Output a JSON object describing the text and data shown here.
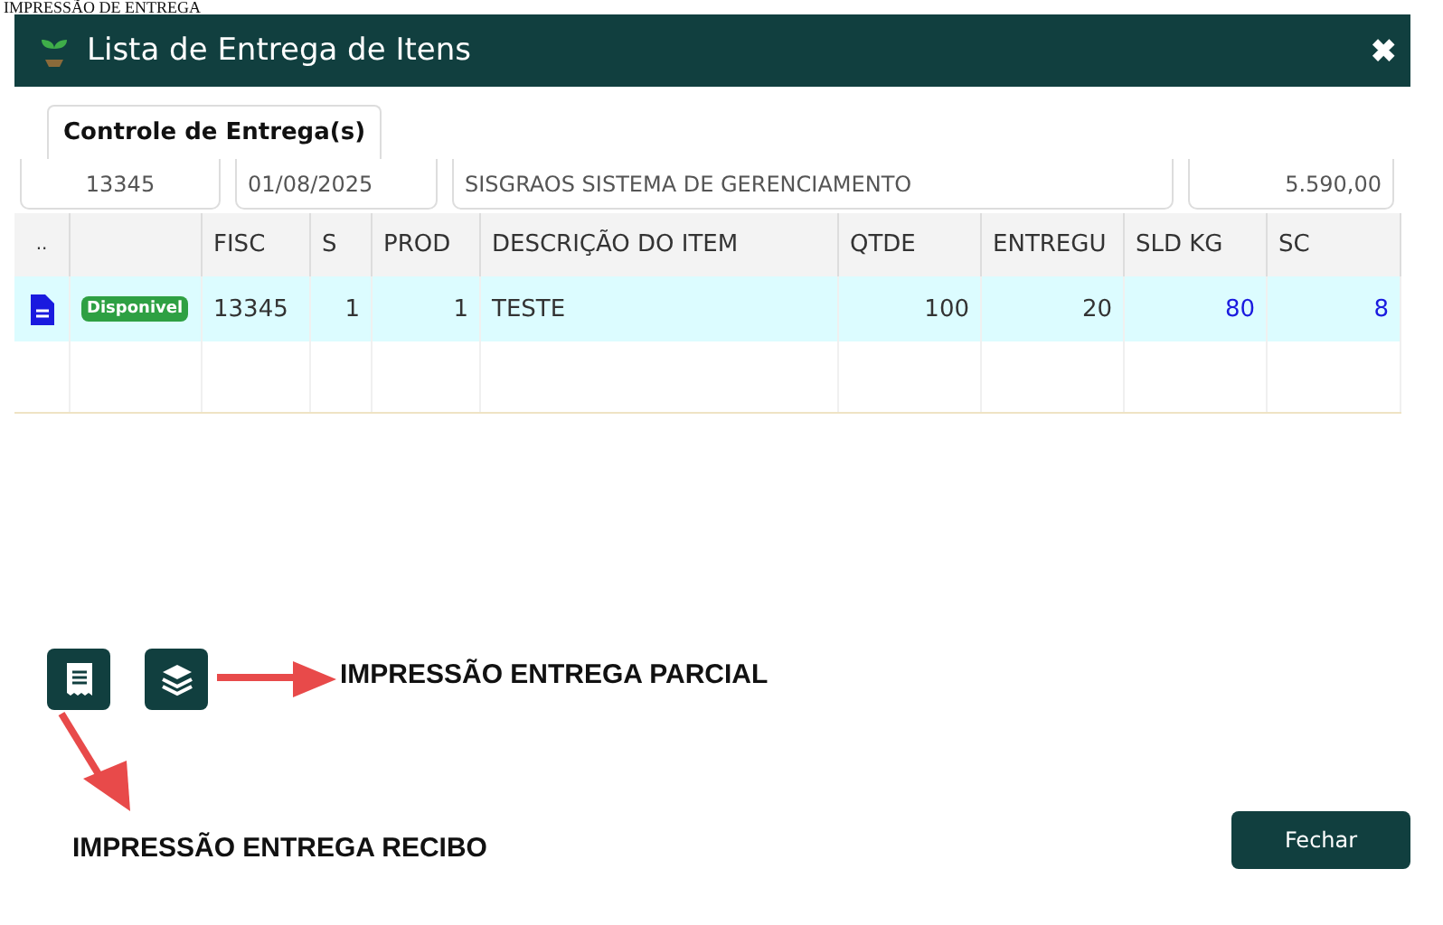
{
  "page_heading": "IMPRESSÃO DE ENTREGA",
  "window": {
    "title": "Lista de Entrega de Itens",
    "close": "✖"
  },
  "tabs": [
    {
      "label": "Controle de Entrega(s)",
      "selected": true
    }
  ],
  "fields": [
    {
      "value": "13345"
    },
    {
      "value": "01/08/2025"
    },
    {
      "value": "SISGRAOS SISTEMA DE GERENCIAMENTO"
    },
    {
      "value": "5.590,00"
    }
  ],
  "table": {
    "columns": [
      "..",
      "",
      "FISC",
      "S",
      "PROD",
      "DESCRIÇÃO DO ITEM",
      "QTDE",
      "ENTREGU",
      "SLD KG",
      "SC"
    ],
    "rows": [
      {
        "selected": true,
        "color": "#2ea043",
        "cells": [
          "",
          "Disponivel",
          "13345",
          "1",
          "1",
          "TESTE",
          "100",
          "20",
          "80",
          "8"
        ]
      }
    ]
  },
  "toolbar": [
    {
      "kind": "receipt"
    },
    {
      "kind": "layers"
    }
  ],
  "annotations": [
    "IMPRESSÃO ENTREGA PARCIAL",
    "IMPRESSÃO ENTREGA RECIBO"
  ],
  "buttons": [
    "Fechar"
  ]
}
